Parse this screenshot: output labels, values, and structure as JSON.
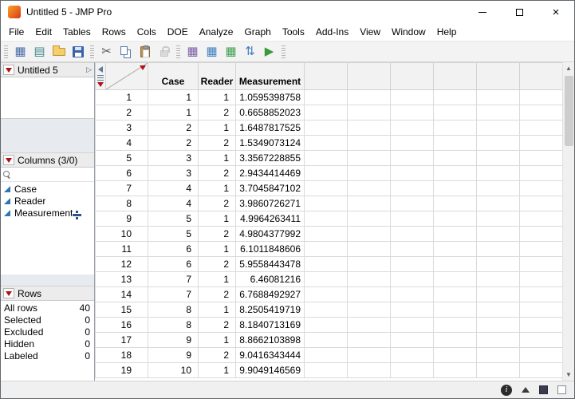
{
  "window": {
    "title": "Untitled 5 - JMP Pro",
    "controls": [
      "minimize",
      "maximize",
      "close"
    ]
  },
  "menu_bar": {
    "items": [
      "File",
      "Edit",
      "Tables",
      "Rows",
      "Cols",
      "DOE",
      "Analyze",
      "Graph",
      "Tools",
      "Add-Ins",
      "View",
      "Window",
      "Help"
    ]
  },
  "toolbar": {
    "icons": [
      {
        "name": "grip-start",
        "type": "sep"
      },
      {
        "name": "new-data-table",
        "type": "glyph",
        "glyph": "▦",
        "color": "#4a6da7"
      },
      {
        "name": "new-journal",
        "type": "glyph",
        "glyph": "▤",
        "color": "#3e8a8a"
      },
      {
        "name": "open",
        "type": "folder"
      },
      {
        "name": "save",
        "type": "floppy"
      },
      {
        "name": "grip-2",
        "type": "sep"
      },
      {
        "name": "cut",
        "type": "glyph",
        "glyph": "✂",
        "color": "#555555"
      },
      {
        "name": "copy",
        "type": "copy"
      },
      {
        "name": "paste",
        "type": "paste"
      },
      {
        "name": "lock",
        "type": "lock",
        "disabled": true
      },
      {
        "name": "grip-3",
        "type": "sep"
      },
      {
        "name": "data-table",
        "type": "glyph",
        "glyph": "▦",
        "color": "#7b5ea7"
      },
      {
        "name": "summary-table",
        "type": "glyph",
        "glyph": "▦",
        "color": "#3f7fbf"
      },
      {
        "name": "join-tables",
        "type": "glyph",
        "glyph": "▦",
        "color": "#3f9f4f"
      },
      {
        "name": "sort",
        "type": "glyph",
        "glyph": "⇅",
        "color": "#3f7fbf"
      },
      {
        "name": "run-script",
        "type": "glyph",
        "glyph": "▶",
        "color": "#3a9a3a"
      },
      {
        "name": "grip-end",
        "type": "sep"
      }
    ]
  },
  "sidebar": {
    "table_panel": {
      "title": "Untitled 5"
    },
    "columns_panel": {
      "title": "Columns (3/0)",
      "search": {
        "value": "",
        "placeholder": ""
      },
      "items": [
        {
          "name": "Case",
          "icon": "continuous-column"
        },
        {
          "name": "Reader",
          "icon": "continuous-column"
        },
        {
          "name": "Measurement",
          "icon": "continuous-column"
        }
      ],
      "cursor_icon": "plus-cursor"
    },
    "rows_panel": {
      "title": "Rows",
      "stats": [
        {
          "label": "All rows",
          "value": "40"
        },
        {
          "label": "Selected",
          "value": "0"
        },
        {
          "label": "Excluded",
          "value": "0"
        },
        {
          "label": "Hidden",
          "value": "0"
        },
        {
          "label": "Labeled",
          "value": "0"
        }
      ]
    }
  },
  "grid": {
    "columns": [
      "Case",
      "Reader",
      "Measurement"
    ],
    "rows": [
      [
        1,
        1,
        1,
        "1.0595398758"
      ],
      [
        2,
        1,
        2,
        "0.6658852023"
      ],
      [
        3,
        2,
        1,
        "1.6487817525"
      ],
      [
        4,
        2,
        2,
        "1.5349073124"
      ],
      [
        5,
        3,
        1,
        "3.3567228855"
      ],
      [
        6,
        3,
        2,
        "2.9434414469"
      ],
      [
        7,
        4,
        1,
        "3.7045847102"
      ],
      [
        8,
        4,
        2,
        "3.9860726271"
      ],
      [
        9,
        5,
        1,
        "4.9964263411"
      ],
      [
        10,
        5,
        2,
        "4.9804377992"
      ],
      [
        11,
        6,
        1,
        "6.1011848606"
      ],
      [
        12,
        6,
        2,
        "5.9558443478"
      ],
      [
        13,
        7,
        1,
        "6.46081216"
      ],
      [
        14,
        7,
        2,
        "6.7688492927"
      ],
      [
        15,
        8,
        1,
        "8.2505419719"
      ],
      [
        16,
        8,
        2,
        "8.1840713169"
      ],
      [
        17,
        9,
        1,
        "8.8662103898"
      ],
      [
        18,
        9,
        2,
        "9.0416343444"
      ],
      [
        19,
        10,
        1,
        "9.9049146569"
      ]
    ]
  },
  "status_bar": {
    "icons": [
      "info",
      "caret-up",
      "selection-square-dark",
      "selection-square-light"
    ]
  },
  "colors": {
    "accent_red": "#b11116",
    "continuous_column_blue": "#2e75b6"
  }
}
